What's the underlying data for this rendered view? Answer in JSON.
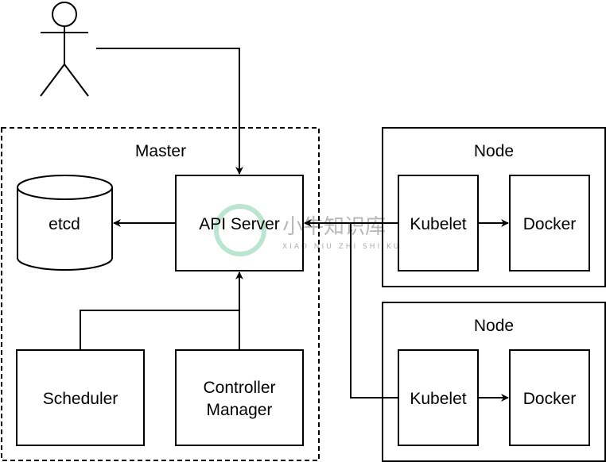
{
  "master": {
    "label": "Master"
  },
  "etcd": {
    "label": "etcd"
  },
  "api_server": {
    "label": "API Server"
  },
  "scheduler": {
    "label": "Scheduler"
  },
  "controller_manager": {
    "line1": "Controller",
    "line2": "Manager"
  },
  "nodes": [
    {
      "label": "Node",
      "kubelet": "Kubelet",
      "docker": "Docker"
    },
    {
      "label": "Node",
      "kubelet": "Kubelet",
      "docker": "Docker"
    }
  ],
  "watermark": {
    "text": "小牛知识库",
    "subtext": "XIAO NIU ZHI SHI KU"
  }
}
